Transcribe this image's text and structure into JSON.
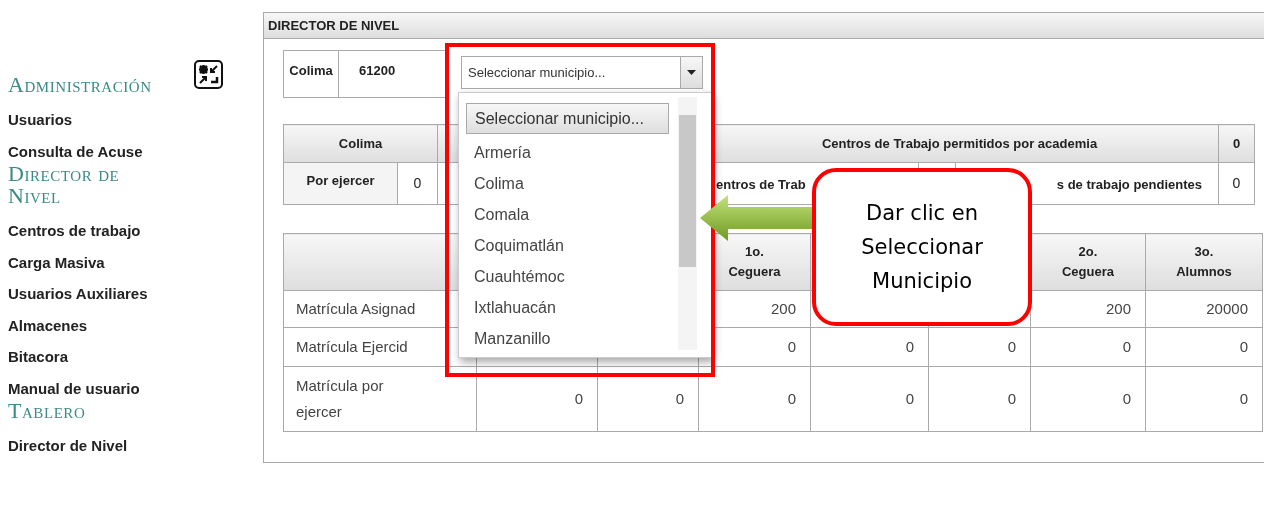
{
  "sidebar": {
    "sections": [
      {
        "title": "Administración",
        "items": [
          {
            "label": "Usuarios"
          },
          {
            "label": "Consulta de Acuse"
          }
        ]
      },
      {
        "title": "Director de Nivel",
        "items": [
          {
            "label": "Centros de trabajo"
          },
          {
            "label": "Carga Masiva"
          },
          {
            "label": "Usuarios Auxiliares"
          },
          {
            "label": "Almacenes"
          },
          {
            "label": "Bitacora"
          },
          {
            "label": "Manual de usuario"
          }
        ]
      },
      {
        "title": "Tablero",
        "items": [
          {
            "label": "Director de Nivel"
          }
        ]
      }
    ]
  },
  "panel": {
    "title": "DIRECTOR DE NIVEL",
    "location": {
      "state": "Colima",
      "code": "61200"
    },
    "municipio_select": {
      "placeholder": "Seleccionar municipio...",
      "expanded": true,
      "options": [
        {
          "label": "Seleccionar municipio...",
          "selected": true
        },
        {
          "label": "Armería",
          "selected": false
        },
        {
          "label": "Colima",
          "selected": false
        },
        {
          "label": "Comala",
          "selected": false
        },
        {
          "label": "Coquimatlán",
          "selected": false
        },
        {
          "label": "Cuauhtémoc",
          "selected": false
        },
        {
          "label": "Ixtlahuacán",
          "selected": false
        },
        {
          "label": "Manzanillo",
          "selected": false
        }
      ]
    },
    "summary_table": {
      "state": "Colima",
      "allowed_label": "Centros de Trabajo permitidos por academia",
      "allowed_value": "0",
      "to_exercise_label": "Por ejercer",
      "to_exercise_value": "0",
      "work_centers_label": "entros de Trab",
      "pending_label": "s de trabajo pendientes",
      "pending_value": "0"
    },
    "enrollment_table": {
      "columns": {
        "column_4": "1o. Ceguera",
        "column_7": "2o. Ceguera",
        "column_8": "3o. Alumnos"
      },
      "rows": [
        {
          "label": "Matrícula Asignad",
          "cells": {
            "column_4": "200",
            "column_7": "200",
            "column_8": "20000"
          }
        },
        {
          "label": "Matrícula Ejercid",
          "cells": {
            "column_4": "0",
            "column_5": "0",
            "column_6": "0",
            "column_7": "0",
            "column_8": "0"
          }
        },
        {
          "label": "Matrícula por ejercer",
          "cells": {
            "column_2": "0",
            "column_3": "0",
            "column_4": "0",
            "column_5": "0",
            "column_6": "0",
            "column_7": "0",
            "column_8": "0"
          }
        }
      ]
    }
  },
  "annotation": {
    "callout": "Dar clic en Seleccionar Municipio"
  }
}
